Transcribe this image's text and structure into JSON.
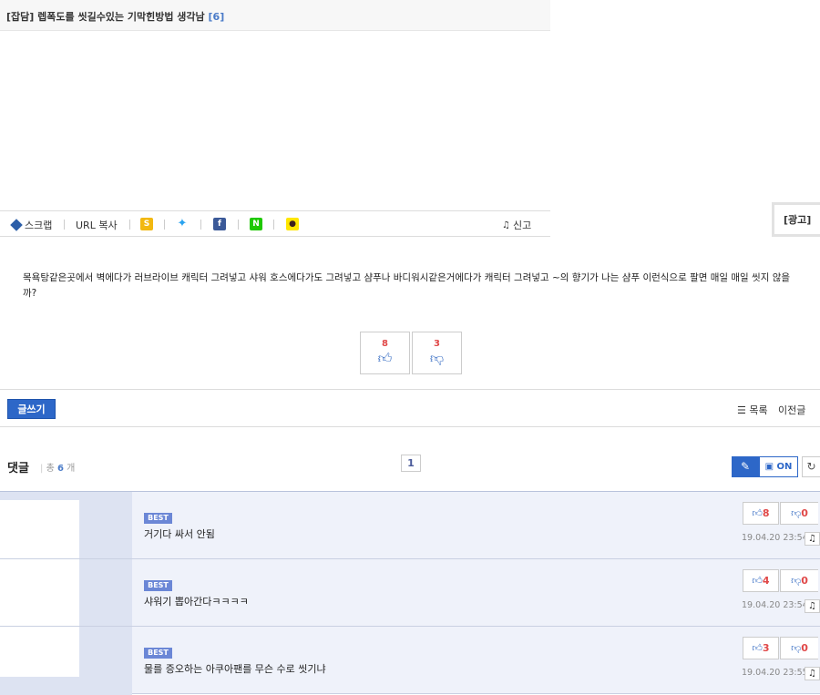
{
  "post": {
    "category": "[잡담]",
    "title": "렙폭도를 씻길수있는 기막힌방법 생각남",
    "comment_count": "[6]",
    "body": "목욕탕같은곳에서 벽에다가 러브라이브 캐릭터 그려넣고 샤워 호스에다가도 그려넣고 샴푸나 바디워시같은거에다가 캐릭터 그려넣고 ~의 향기가 나는 샴푸 이런식으로 팔면 매일 매일 씻지 않을까?"
  },
  "share": {
    "scrap": "스크랩",
    "url_copy": "URL 복사",
    "report": "신고",
    "icons": [
      "kakaostory-icon",
      "twitter-icon",
      "facebook-icon",
      "naver-icon",
      "kakaotalk-icon"
    ]
  },
  "ad": {
    "label": "[광고]"
  },
  "votes": {
    "up": "8",
    "down": "3"
  },
  "nav": {
    "write": "글쓰기",
    "list": "목록",
    "prev": "이전글"
  },
  "comments_header": {
    "title": "댓글",
    "total_prefix": "총",
    "total_count": "6",
    "total_suffix": "개",
    "page": "1",
    "image_toggle": "ON"
  },
  "comments": [
    {
      "badge": "BEST",
      "text": "거기다 싸서 안됨",
      "up": "8",
      "down": "0",
      "date": "19.04.20 23:54"
    },
    {
      "badge": "BEST",
      "text": "샤워기 뽑아간다ㅋㅋㅋㅋ",
      "up": "4",
      "down": "0",
      "date": "19.04.20 23:54"
    },
    {
      "badge": "BEST",
      "text": "물를 증오하는 아쿠아팬를 무슨 수로 씻기냐",
      "up": "3",
      "down": "0",
      "date": "19.04.20 23:55"
    }
  ],
  "colors": {
    "accent": "#2d67c8",
    "badge": "#6b87d6",
    "vote_count": "#e04848",
    "comment_bg": "#eff2fa"
  }
}
